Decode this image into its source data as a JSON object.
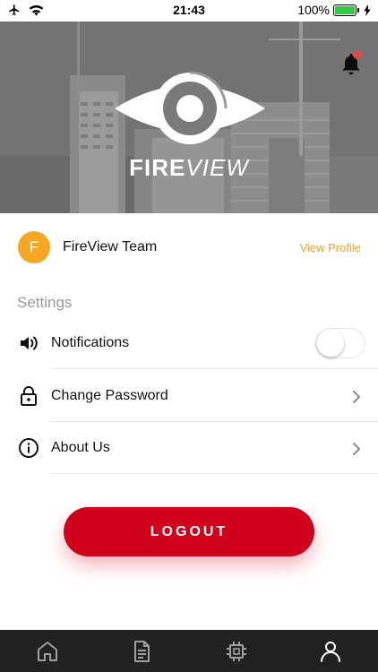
{
  "status_bar": {
    "time": "21:43",
    "battery_percent": "100%",
    "icons": [
      "airplane-icon",
      "wifi-icon",
      "battery-icon",
      "charging-bolt-icon"
    ]
  },
  "hero": {
    "brand_bold": "FIRE",
    "brand_light": "VIEW",
    "notification_badge": true,
    "badge_color": "#e24a4a"
  },
  "profile": {
    "avatar_initial": "F",
    "avatar_color": "#f5a623",
    "team_name": "FireView Team",
    "view_profile_label": "View Profile",
    "link_color": "#e8a33a"
  },
  "settings": {
    "section_title": "Settings",
    "items": [
      {
        "label": "Notifications",
        "icon": "speaker-icon",
        "control": "toggle",
        "enabled": false
      },
      {
        "label": "Change Password",
        "icon": "lock-icon",
        "control": "chevron"
      },
      {
        "label": "About Us",
        "icon": "info-icon",
        "control": "chevron"
      }
    ]
  },
  "logout": {
    "label": "LOGOUT",
    "color": "#d0021b"
  },
  "tab_bar": {
    "background": "#222222",
    "tabs": [
      {
        "icon": "home-icon"
      },
      {
        "icon": "document-icon"
      },
      {
        "icon": "chip-icon"
      },
      {
        "icon": "user-icon",
        "active": true
      }
    ]
  }
}
